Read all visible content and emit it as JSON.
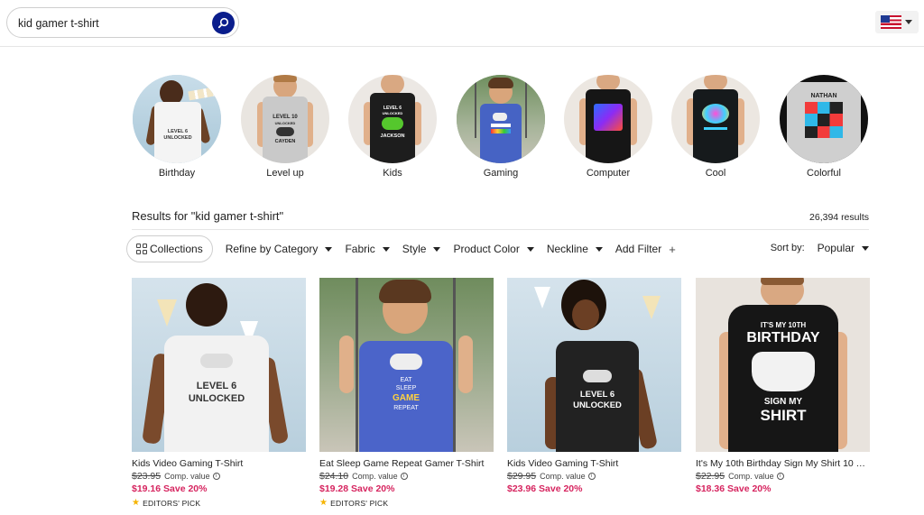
{
  "search": {
    "value": "kid gamer t-shirt",
    "placeholder": ""
  },
  "locale": {
    "flag": "us-flag-icon"
  },
  "categories": [
    {
      "label": "Birthday"
    },
    {
      "label": "Level up"
    },
    {
      "label": "Kids"
    },
    {
      "label": "Gaming"
    },
    {
      "label": "Computer"
    },
    {
      "label": "Cool"
    },
    {
      "label": "Colorful"
    }
  ],
  "category_art": {
    "birthday_text": "LEVEL 6\nUNLOCKED",
    "levelup_text1": "LEVEL 10",
    "levelup_text2": "UNLOCKED",
    "levelup_name": "CAYDEN",
    "kids_text1": "LEVEL 6",
    "kids_text2": "UNLOCKED",
    "kids_name": "JACKSON",
    "colorful_name": "NATHAN"
  },
  "results": {
    "title": "Results for \"kid gamer t-shirt\"",
    "count": "26,394 results"
  },
  "filters": {
    "collections": "Collections",
    "items": [
      {
        "label": "Refine by Category"
      },
      {
        "label": "Fabric"
      },
      {
        "label": "Style"
      },
      {
        "label": "Product Color"
      },
      {
        "label": "Neckline"
      }
    ],
    "add_filter": "Add Filter",
    "sort_label": "Sort by:",
    "sort_value": "Popular"
  },
  "products": [
    {
      "name": "Kids Video Gaming T-Shirt",
      "original": "$23.95",
      "comp": "Comp. value",
      "sale": "$19.16 Save 20%",
      "pick": "EDITORS' PICK",
      "art1": "LEVEL 6",
      "art2": "UNLOCKED"
    },
    {
      "name": "Eat Sleep Game Repeat Gamer T-Shirt",
      "original": "$24.10",
      "comp": "Comp. value",
      "sale": "$19.28 Save 20%",
      "pick": "EDITORS' PICK",
      "art1": "EAT",
      "art2": "SLEEP",
      "art3": "GAME",
      "art4": "REPEAT"
    },
    {
      "name": "Kids Video Gaming T-Shirt",
      "original": "$29.95",
      "comp": "Comp. value",
      "sale": "$23.96 Save 20%",
      "art1": "LEVEL 6",
      "art2": "UNLOCKED"
    },
    {
      "name": "It's My 10th Birthday Sign My Shirt 10 Yea...",
      "original": "$22.95",
      "comp": "Comp. value",
      "sale": "$18.36 Save 20%",
      "art1": "IT'S MY 10TH",
      "art2": "BIRTHDAY",
      "art3": "SIGN MY",
      "art4": "SHIRT"
    }
  ],
  "colors": {
    "accent": "#0a1d8c",
    "sale": "#d6245f",
    "star": "#f5b400"
  }
}
